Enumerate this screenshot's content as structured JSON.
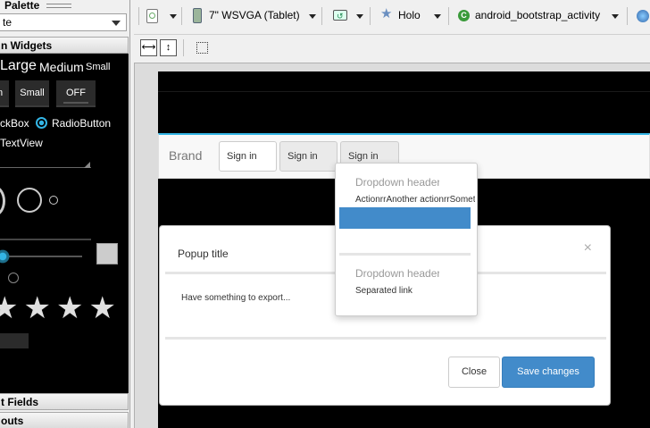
{
  "palette": {
    "title": "Palette",
    "selector": "te",
    "category_top": "n Widgets",
    "widgets": {
      "large": "Large",
      "medium": "Medium",
      "small": "Small",
      "button_partial": "n",
      "small_button": "Small",
      "toggle_off": "OFF",
      "checkbox": "ckBox",
      "radio": "RadioButton",
      "textview": "TextView"
    },
    "category_text_fields": "t Fields",
    "category_layouts": "outs"
  },
  "toolbar": {
    "device": "7\" WSVGA (Tablet)",
    "theme": "Holo",
    "activity": "android_bootstrap_activity"
  },
  "preview": {
    "brand": "Brand",
    "signin_1": "Sign in",
    "signin_2": "Sign in",
    "signin_3": "Sign in",
    "dropdown": {
      "header_1": "Dropdown header",
      "actions": "ActionrrAnother actionrrSomething",
      "header_2": "Dropdown header",
      "separated": "Separated link"
    },
    "modal": {
      "title": "Popup title",
      "close_glyph": "×",
      "body": "Have something to export...",
      "close_btn": "Close",
      "save_btn": "Save changes"
    }
  },
  "colors": {
    "accent": "#33b5e5",
    "primary": "#428bca"
  }
}
